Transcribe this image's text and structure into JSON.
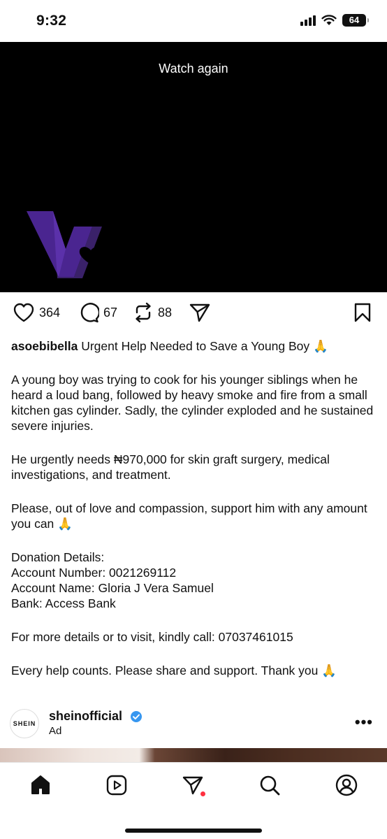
{
  "status_bar": {
    "time": "9:32",
    "battery": "64",
    "icons": [
      "signal-icon",
      "wifi-icon",
      "battery-icon"
    ]
  },
  "video": {
    "overlay_text": "Watch again",
    "logo": "v-heart-logo"
  },
  "actions": {
    "likes": "364",
    "comments": "67",
    "reposts": "88"
  },
  "post": {
    "username": "asoebibella",
    "lines": [
      {
        "text": "Urgent Help Needed to Save a Young Boy 🙏"
      },
      {
        "text": "A young boy was trying to cook for his younger siblings when he heard a loud bang, followed by heavy smoke and fire from a small kitchen gas cylinder. Sadly, the cylinder exploded and he sustained severe injuries."
      },
      {
        "text": "He urgently needs ₦970,000 for skin graft surgery, medical investigations, and treatment."
      },
      {
        "text": "Please, out of love and compassion, support him with any amount you can 🙏"
      },
      {
        "text": "Donation Details:"
      },
      {
        "text": "Account Number: 0021269112"
      },
      {
        "text": "Account Name: Gloria J Vera Samuel"
      },
      {
        "text": "Bank: Access Bank"
      },
      {
        "text": "For more details or to visit, kindly call: 07037461015"
      },
      {
        "text": "Every help counts. Please share and support. Thank you 🙏"
      }
    ]
  },
  "ad": {
    "avatar_text": "SHEIN",
    "account": "sheinofficial",
    "label": "Ad",
    "more": "•••"
  },
  "nav": {
    "items": [
      "home-icon",
      "reels-icon",
      "direct-icon",
      "search-icon",
      "profile-icon"
    ],
    "active_color": "#111111",
    "dot_color": "#ff3040"
  },
  "colors": {
    "verified": "#3797f0",
    "logo_purple": "#5b2ea6"
  }
}
